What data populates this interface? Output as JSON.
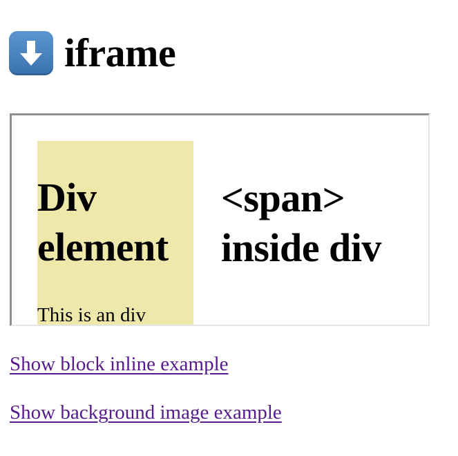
{
  "page": {
    "title": "iframe",
    "title_icon": "down-arrow-icon"
  },
  "iframe": {
    "div_heading": "Div element",
    "div_text": "This is an div",
    "span_text": "<span> inside div",
    "div_background": "#eee8aa"
  },
  "links": {
    "block_inline": "Show block inline example",
    "background_image": "Show background image example",
    "visited_color": "#551a8b"
  }
}
